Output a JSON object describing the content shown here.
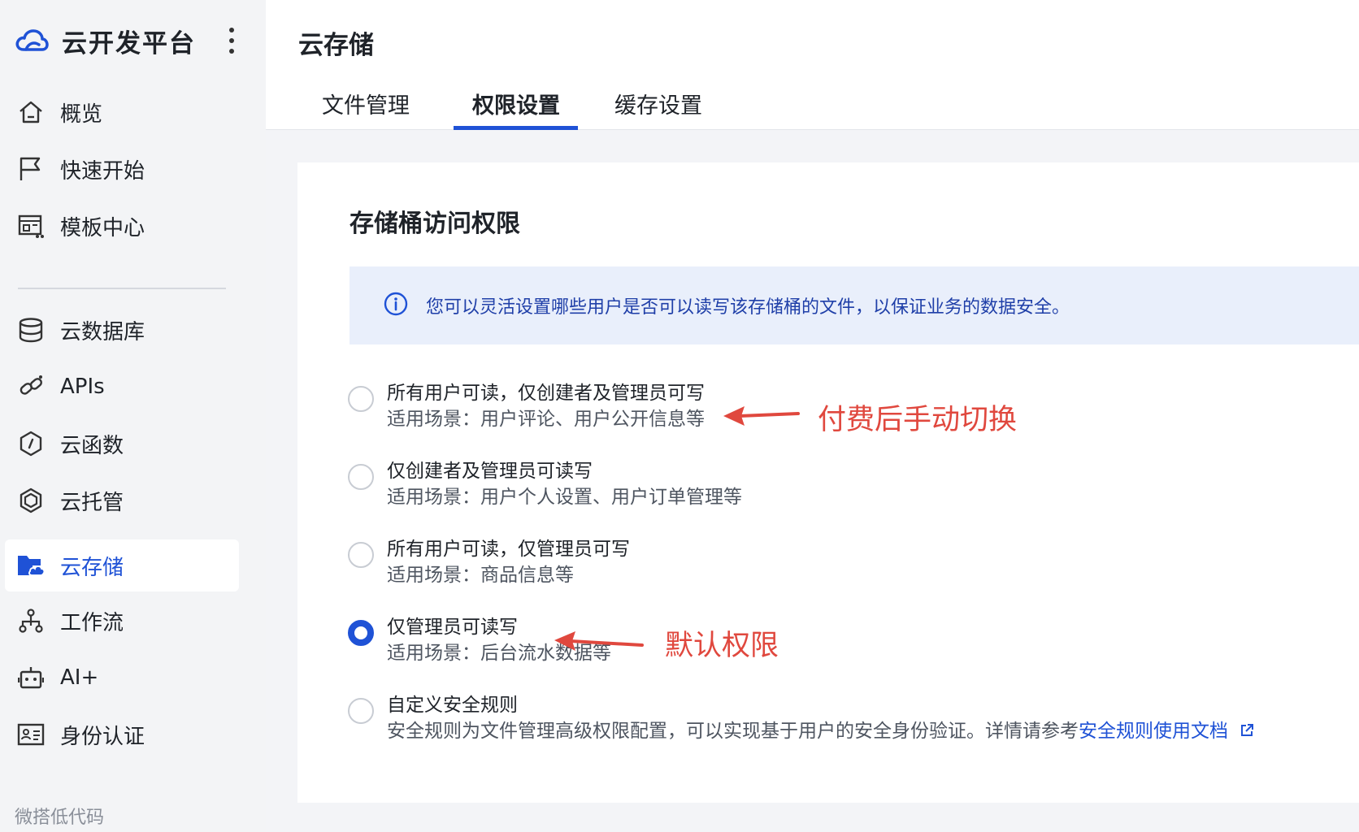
{
  "app": {
    "brand_title": "云开发平台"
  },
  "sidebar": {
    "items": [
      {
        "label": "概览",
        "icon": "home-icon"
      },
      {
        "label": "快速开始",
        "icon": "flag-icon"
      },
      {
        "label": "模板中心",
        "icon": "template-icon"
      },
      {
        "label": "云数据库",
        "icon": "database-icon"
      },
      {
        "label": "APIs",
        "icon": "link-icon"
      },
      {
        "label": "云函数",
        "icon": "function-icon"
      },
      {
        "label": "云托管",
        "icon": "hexagon-icon"
      },
      {
        "label": "云存储",
        "icon": "folder-cloud-icon",
        "active": true
      },
      {
        "label": "工作流",
        "icon": "workflow-icon"
      },
      {
        "label": "AI+",
        "icon": "robot-icon"
      },
      {
        "label": "身份认证",
        "icon": "id-card-icon"
      }
    ],
    "section_label": "微搭低代码"
  },
  "header": {
    "title": "云存储",
    "tabs": [
      {
        "label": "文件管理"
      },
      {
        "label": "权限设置",
        "active": true
      },
      {
        "label": "缓存设置"
      }
    ]
  },
  "main": {
    "card_title": "存储桶访问权限",
    "info_text": "您可以灵活设置哪些用户是否可以读写该存储桶的文件，以保证业务的数据安全。",
    "options": [
      {
        "title": "所有用户可读，仅创建者及管理员可写",
        "desc": "适用场景：用户评论、用户公开信息等",
        "checked": false
      },
      {
        "title": "仅创建者及管理员可读写",
        "desc": "适用场景：用户个人设置、用户订单管理等",
        "checked": false
      },
      {
        "title": "所有用户可读，仅管理员可写",
        "desc": "适用场景：商品信息等",
        "checked": false
      },
      {
        "title": "仅管理员可读写",
        "desc": "适用场景：后台流水数据等",
        "checked": true
      },
      {
        "title": "自定义安全规则",
        "desc": "安全规则为文件管理高级权限配置，可以实现基于用户的安全身份验证。详情请参考",
        "link": "安全规则使用文档",
        "checked": false
      }
    ]
  },
  "annotations": {
    "first": "付费后手动切换",
    "second": "默认权限"
  },
  "colors": {
    "accent": "#1f52d6",
    "annotation": "#e0483e",
    "info_bg": "#e9effb"
  }
}
